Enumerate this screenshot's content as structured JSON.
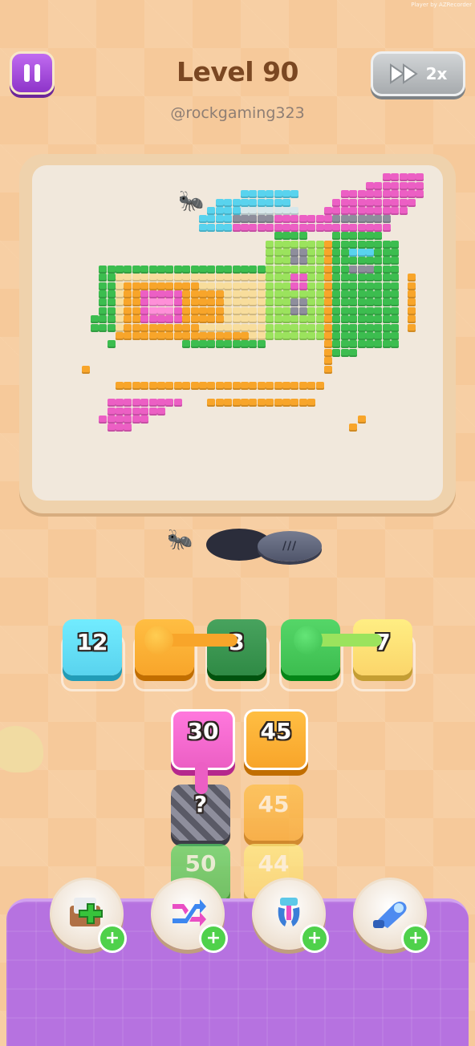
{
  "status_bar": {
    "recording_text": "Player by AZRecorder"
  },
  "header": {
    "level_title": "Level 90",
    "username": "@rockgaming323",
    "speed_label": "2x"
  },
  "colors": {
    "pink": "#ec5fc4",
    "orange": "#f8a52a",
    "yellow": "#fbd56a",
    "green": "#3cbd4f",
    "light_green": "#9be35d",
    "dark_green": "#2f8a45",
    "cyan": "#59d3ee",
    "gray": "#8e8e9c",
    "purple_ui": "#b672e0"
  },
  "queue": [
    {
      "number": "12",
      "color": "cyan"
    },
    {
      "number": "",
      "color": "orange"
    },
    {
      "number": "3",
      "color": "dark_green"
    },
    {
      "number": "",
      "color": "green"
    },
    {
      "number": "7",
      "color": "yellow"
    }
  ],
  "grid_tiles": [
    {
      "number": "30",
      "color": "pink",
      "state": "active"
    },
    {
      "number": "45",
      "color": "orange",
      "state": "active"
    },
    {
      "number": "?",
      "color": "gray",
      "state": "locked"
    },
    {
      "number": "45",
      "color": "orange",
      "state": "inactive"
    },
    {
      "number": "50",
      "color": "green",
      "state": "inactive"
    },
    {
      "number": "44",
      "color": "yellow",
      "state": "inactive"
    }
  ],
  "boosters": [
    {
      "name": "add-slot",
      "icon": "add-box-icon"
    },
    {
      "name": "shuffle",
      "icon": "shuffle-arrows-icon"
    },
    {
      "name": "magnet",
      "icon": "magnet-claw-icon"
    },
    {
      "name": "vacuum",
      "icon": "vacuum-icon"
    }
  ]
}
